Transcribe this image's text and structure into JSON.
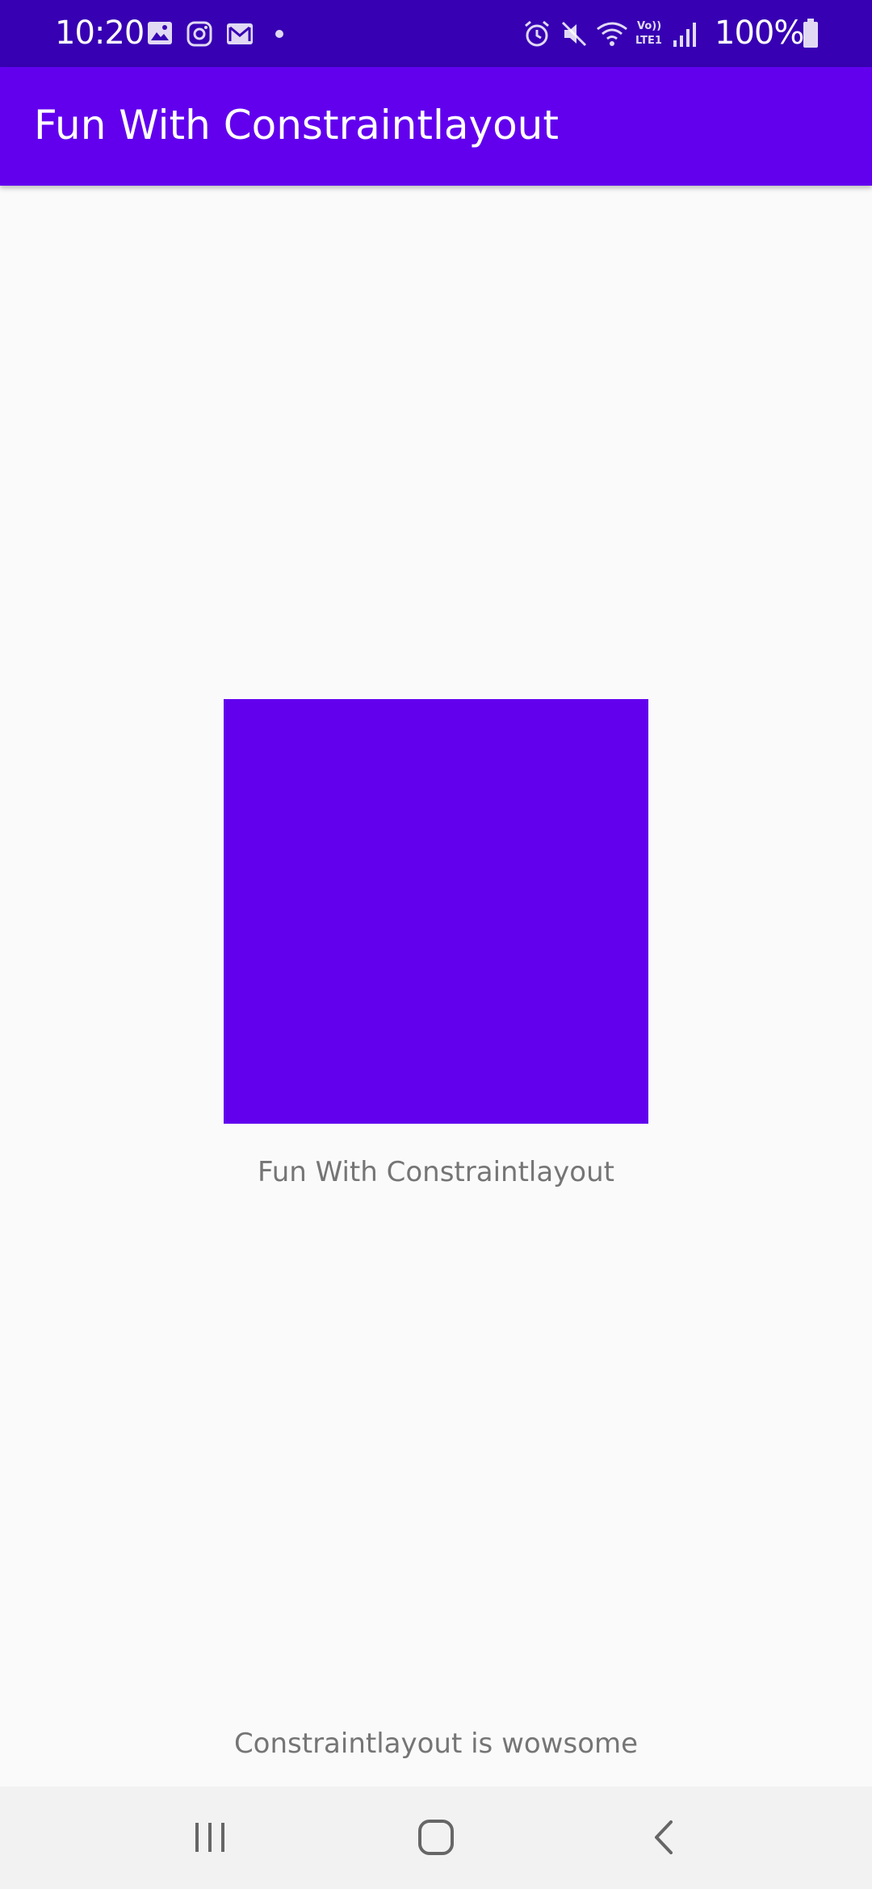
{
  "status_bar": {
    "time": "10:20",
    "battery_percent": "100%",
    "icons_left": [
      "gallery-icon",
      "instagram-icon",
      "gmail-icon",
      "notification-dot-icon"
    ],
    "icons_right": [
      "alarm-icon",
      "mute-icon",
      "wifi-icon",
      "volte-lte1-icon",
      "signal-icon",
      "battery-icon"
    ],
    "volte_label": "Vo)) LTE1"
  },
  "app_bar": {
    "title": "Fun With Constraintlayout"
  },
  "main": {
    "box_caption": "Fun With Constraintlayout",
    "bottom_text": "Constraintlayout is wowsome"
  },
  "nav_bar": {
    "buttons": [
      "recent-apps",
      "home",
      "back"
    ]
  },
  "colors": {
    "status_bar": "#3700b3",
    "primary": "#6200ee",
    "background": "#fafafa",
    "caption_text": "#757575"
  }
}
